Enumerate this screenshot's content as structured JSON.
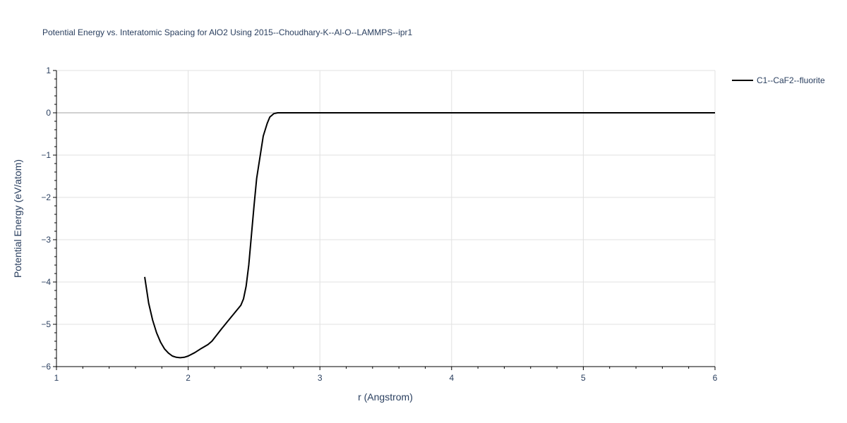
{
  "chart_data": {
    "type": "line",
    "title": "Potential Energy vs. Interatomic Spacing for AlO2 Using 2015--Choudhary-K--Al-O--LAMMPS--ipr1",
    "xlabel": "r (Angstrom)",
    "ylabel": "Potential Energy (eV/atom)",
    "xlim": [
      1,
      6
    ],
    "ylim": [
      -6,
      1
    ],
    "xticks": [
      "1",
      "2",
      "3",
      "4",
      "5",
      "6"
    ],
    "yticks": [
      "1",
      "0",
      "−1",
      "−2",
      "−3",
      "−4",
      "−5",
      "−6"
    ],
    "grid": true,
    "legend_position": "top-right",
    "series": [
      {
        "name": "C1--CaF2--fluorite",
        "color": "#000000",
        "x": [
          1.67,
          1.7,
          1.73,
          1.76,
          1.79,
          1.82,
          1.85,
          1.88,
          1.91,
          1.94,
          1.97,
          2.0,
          2.05,
          2.1,
          2.15,
          2.18,
          2.2,
          2.25,
          2.3,
          2.35,
          2.4,
          2.42,
          2.44,
          2.46,
          2.48,
          2.5,
          2.52,
          2.55,
          2.57,
          2.6,
          2.62,
          2.65,
          2.68,
          2.7,
          2.8,
          3.0,
          3.5,
          4.0,
          4.5,
          5.0,
          5.5,
          6.0
        ],
        "y": [
          -3.88,
          -4.5,
          -4.9,
          -5.2,
          -5.42,
          -5.58,
          -5.68,
          -5.75,
          -5.78,
          -5.79,
          -5.78,
          -5.75,
          -5.67,
          -5.57,
          -5.48,
          -5.4,
          -5.32,
          -5.12,
          -4.93,
          -4.74,
          -4.55,
          -4.4,
          -4.1,
          -3.6,
          -2.9,
          -2.2,
          -1.55,
          -0.95,
          -0.55,
          -0.25,
          -0.1,
          -0.02,
          0.0,
          0.0,
          0.0,
          0.0,
          0.0,
          0.0,
          0.0,
          0.0,
          0.0,
          0.0
        ]
      }
    ]
  }
}
